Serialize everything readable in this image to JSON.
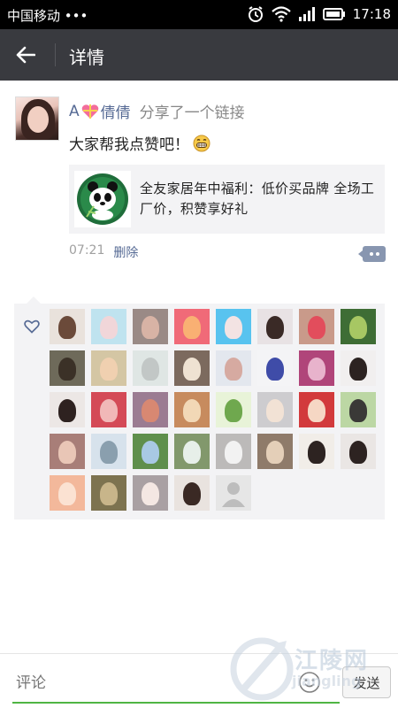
{
  "status_bar": {
    "carrier": "中国移动 •••",
    "time": "17:18",
    "icons": [
      "alarm-icon",
      "wifi-icon",
      "signal-icon",
      "battery-icon"
    ]
  },
  "header": {
    "title": "详情",
    "back_icon": "arrow-left-icon",
    "background": "#393a3f"
  },
  "post": {
    "author_prefix": "A",
    "author_name": "倩倩",
    "action": "分享了一个链接",
    "message": "大家帮我点赞吧！",
    "link": {
      "thumbnail_icon": "panda-icon",
      "title": "全友家居年中福利：低价买品牌 全场工厂价，积赞享好礼"
    },
    "time": "07:21",
    "delete_label": "删除",
    "name_color": "#576b95"
  },
  "likes": {
    "icon": "heart-outline-icon",
    "avatars": [
      {
        "bg": "#e9e2dc",
        "fig": "#6b4a3a"
      },
      {
        "bg": "#bfe3ef",
        "fig": "#f1d6d9"
      },
      {
        "bg": "#9a8a86",
        "fig": "#d8b3a5"
      },
      {
        "bg": "#f06a78",
        "fig": "#f9b073"
      },
      {
        "bg": "#58c3ef",
        "fig": "#f3e3e3"
      },
      {
        "bg": "#e8e2e4",
        "fig": "#3a2a26"
      },
      {
        "bg": "#c99a8a",
        "fig": "#e24d5c"
      },
      {
        "bg": "#3e6d35",
        "fig": "#a7c763"
      },
      {
        "bg": "#6e6a5a",
        "fig": "#3b3127"
      },
      {
        "bg": "#d4c6a4",
        "fig": "#f0d0b0"
      },
      {
        "bg": "#dfe6e4",
        "fig": "#c2c7c6"
      },
      {
        "bg": "#7c6a5e",
        "fig": "#efe2d2"
      },
      {
        "bg": "#e3e7ee",
        "fig": "#d6aaa1"
      },
      {
        "bg": "#f4f4f6",
        "fig": "#3f4ca8"
      },
      {
        "bg": "#b0457a",
        "fig": "#e8b3cc"
      },
      {
        "bg": "#f1efef",
        "fig": "#2c2321"
      },
      {
        "bg": "#ece7e5",
        "fig": "#2e2220"
      },
      {
        "bg": "#d44a57",
        "fig": "#f1b8b8"
      },
      {
        "bg": "#9b7c92",
        "fig": "#d88872"
      },
      {
        "bg": "#c78b5e",
        "fig": "#f2d8b6"
      },
      {
        "bg": "#e8f3d8",
        "fig": "#6fa84e"
      },
      {
        "bg": "#cdcccf",
        "fig": "#f2e2d5"
      },
      {
        "bg": "#d23a3c",
        "fig": "#f6d7c4"
      },
      {
        "bg": "#bcd7a4",
        "fig": "#3a3937"
      },
      {
        "bg": "#a87e78",
        "fig": "#e9c6b6"
      },
      {
        "bg": "#d7e2ec",
        "fig": "#8a9fae"
      },
      {
        "bg": "#5f8f4c",
        "fig": "#a8c9e4"
      },
      {
        "bg": "#82986c",
        "fig": "#e7efe9"
      },
      {
        "bg": "#bcbab9",
        "fig": "#f2f2f2"
      },
      {
        "bg": "#8f7b6a",
        "fig": "#e4cfb8"
      },
      {
        "bg": "#f1ede8",
        "fig": "#2d2321"
      },
      {
        "bg": "#eae6e4",
        "fig": "#2d2321"
      },
      {
        "bg": "#f3b89b",
        "fig": "#fbe2d2"
      },
      {
        "bg": "#7d7350",
        "fig": "#c8b58a"
      },
      {
        "bg": "#a9a0a3",
        "fig": "#f4e7e3"
      },
      {
        "bg": "#e9e3df",
        "fig": "#3a2924"
      }
    ],
    "default_avatar_icon": "default-user-icon"
  },
  "comment_bar": {
    "placeholder": "评论",
    "send_label": "发送",
    "emoji_icon": "smiley-face-icon",
    "accent": "#4fb543"
  },
  "watermark": {
    "text": "江陵网",
    "subtext": "jiangling"
  }
}
